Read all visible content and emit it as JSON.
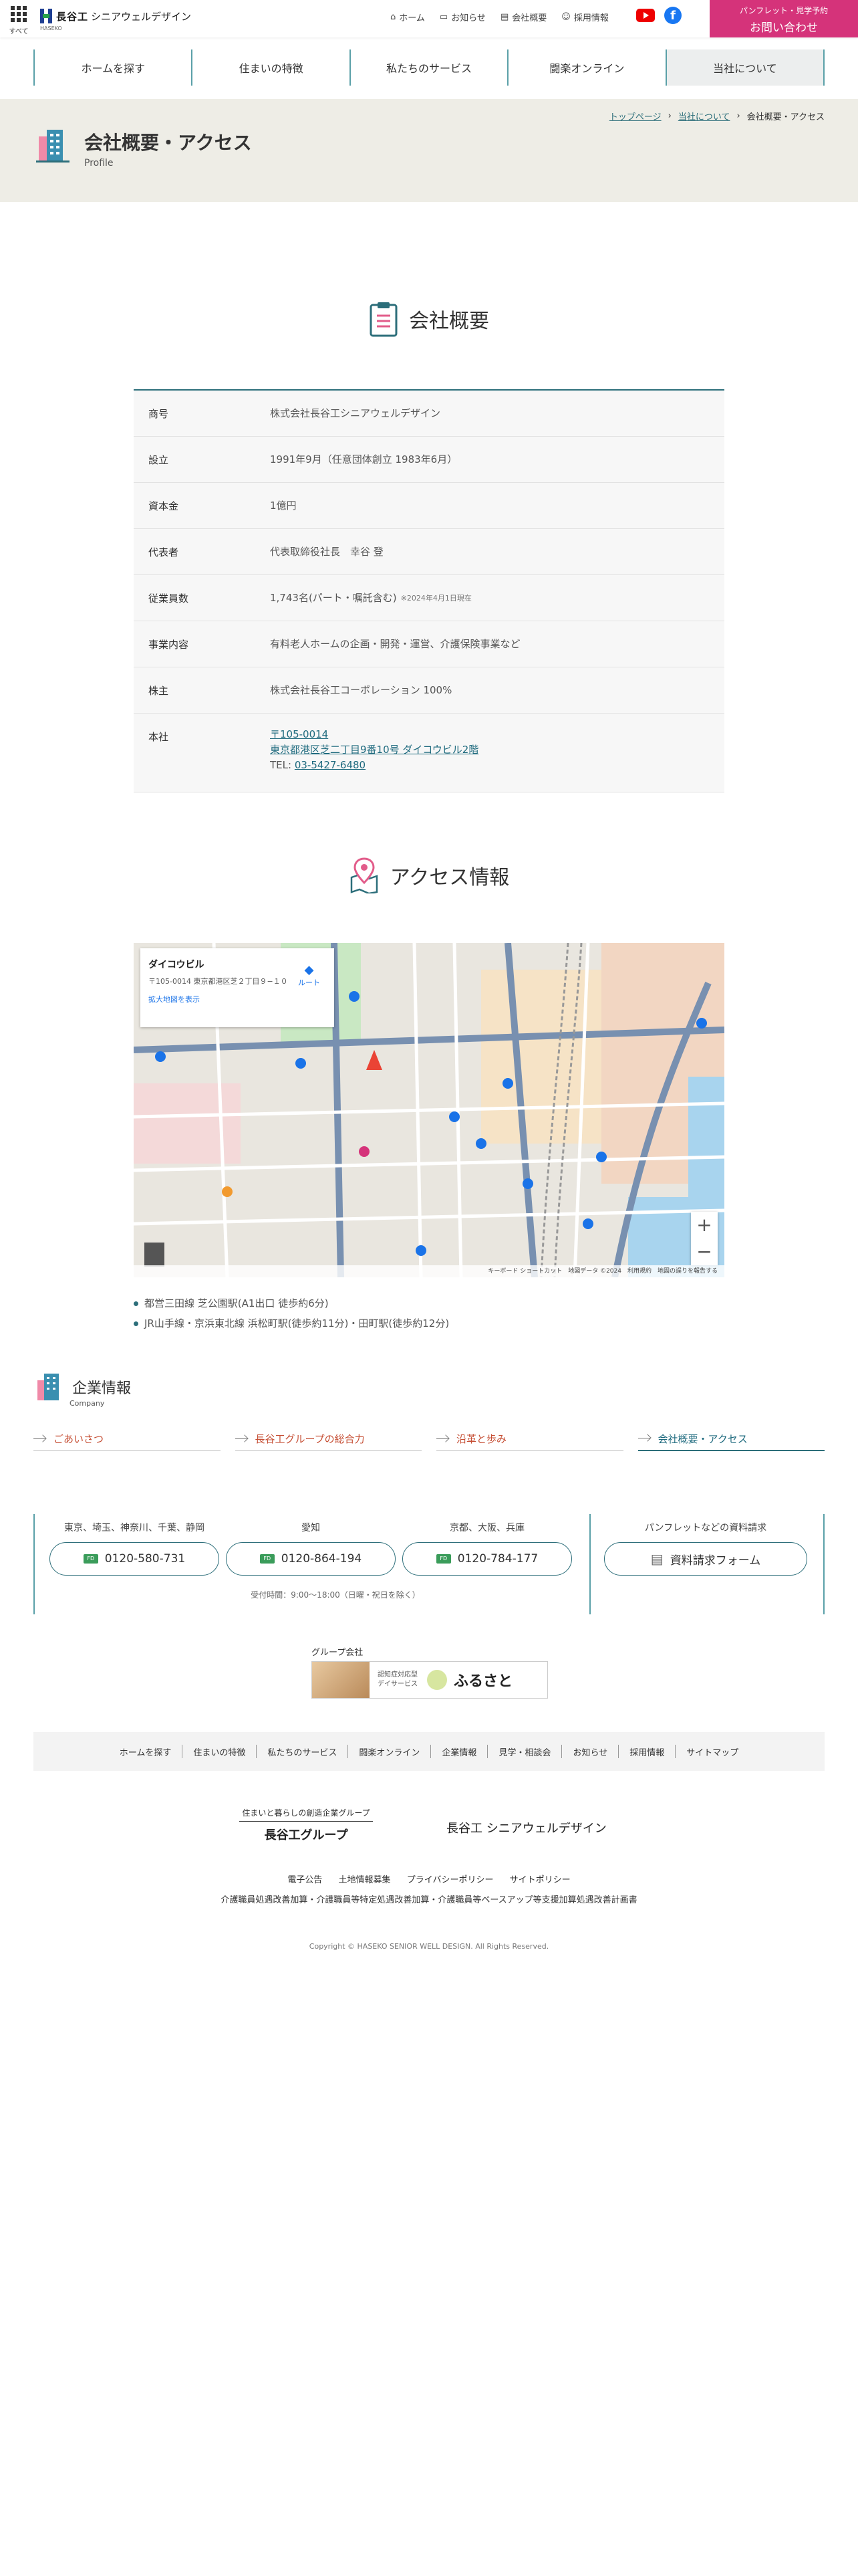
{
  "header": {
    "menu_label": "すべて",
    "brand": "長谷工",
    "brand_sub": "シニアウェルデザイン",
    "brand_small": "HASEKO",
    "nav": [
      "ホーム",
      "お知らせ",
      "会社概要",
      "採用情報"
    ],
    "cta_small": "パンフレット・見学予約",
    "cta_big": "お問い合わせ"
  },
  "gnav": [
    "ホームを探す",
    "住まいの特徴",
    "私たちのサービス",
    "闘楽オンライン",
    "当社について"
  ],
  "page": {
    "breadcrumb": [
      "トップページ",
      "当社について",
      "会社概要・アクセス"
    ],
    "title": "会社概要・アクセス",
    "subtitle": "Profile"
  },
  "profile": {
    "heading": "会社概要",
    "rows": [
      {
        "k": "商号",
        "v": "株式会社長谷工シニアウェルデザイン"
      },
      {
        "k": "設立",
        "v": "1991年9月（任意団体創立 1983年6月）"
      },
      {
        "k": "資本金",
        "v": "1億円"
      },
      {
        "k": "代表者",
        "v": "代表取締役社長　幸谷 登"
      },
      {
        "k": "従業員数",
        "v": "1,743名(パート・嘱託含む)",
        "note": "※2024年4月1日現在"
      },
      {
        "k": "事業内容",
        "v": "有料老人ホームの企画・開発・運営、介護保険事業など"
      },
      {
        "k": "株主",
        "v": "株式会社長谷工コーポレーション 100%"
      }
    ],
    "address": {
      "k": "本社",
      "zip": "〒105-0014",
      "addr": "東京都港区芝二丁目9番10号 ダイコウビル2階",
      "tel_label": "TEL:",
      "tel": "03-5427-6480"
    }
  },
  "access": {
    "heading": "アクセス情報",
    "map": {
      "place": "ダイコウビル",
      "address": "〒105-0014 東京都港区芝２丁目９−１０",
      "route": "ルート",
      "enlarge": "拡大地図を表示",
      "footer": "キーボード ショートカット　地図データ ©2024　利用規約　地図の誤りを報告する"
    },
    "lines": [
      "都営三田線 芝公園駅(A1出口 徒歩約6分)",
      "JR山手線・京浜東北線 浜松町駅(徒歩約11分)・田町駅(徒歩約12分)"
    ]
  },
  "corp": {
    "title": "企業情報",
    "sub": "Company",
    "links": [
      "ごあいさつ",
      "長谷工グループの総合力",
      "沿革と歩み",
      "会社概要・アクセス"
    ]
  },
  "contact": {
    "regions": [
      {
        "name": "東京、埼玉、神奈川、千葉、静岡",
        "tel": "0120-580-731"
      },
      {
        "name": "愛知",
        "tel": "0120-864-194"
      },
      {
        "name": "京都、大阪、兵庫",
        "tel": "0120-784-177"
      }
    ],
    "hours": "受付時間：9:00〜18:00（日曜・祝日を除く）",
    "doc_label": "パンフレットなどの資料請求",
    "doc_button": "資料請求フォーム"
  },
  "group": {
    "label": "グループ会社",
    "banner_text": "認知症対応型\nデイサービス",
    "banner_name": "ふるさと"
  },
  "footer": {
    "nav": [
      "ホームを探す",
      "住まいの特徴",
      "私たちのサービス",
      "闘楽オンライン",
      "企業情報",
      "見学・相談会",
      "お知らせ",
      "採用情報",
      "サイトマップ"
    ],
    "group_tag": "住まいと暮らしの創造企業グループ",
    "group_name": "長谷工グループ",
    "company_name": "長谷工 シニアウェルデザイン",
    "links": [
      "電子公告",
      "土地情報募集",
      "プライバシーポリシー",
      "サイトポリシー"
    ],
    "links2": "介護職員処遇改善加算・介護職員等特定処遇改善加算・介護職員等ベースアップ等支援加算処遇改善計画書",
    "copyright": "Copyright © HASEKO SENIOR WELL DESIGN. All Rights Reserved."
  },
  "colors": {
    "accent": "#2c6e7a",
    "cta": "#d5337a",
    "nav_border": "#5aa0a8"
  }
}
